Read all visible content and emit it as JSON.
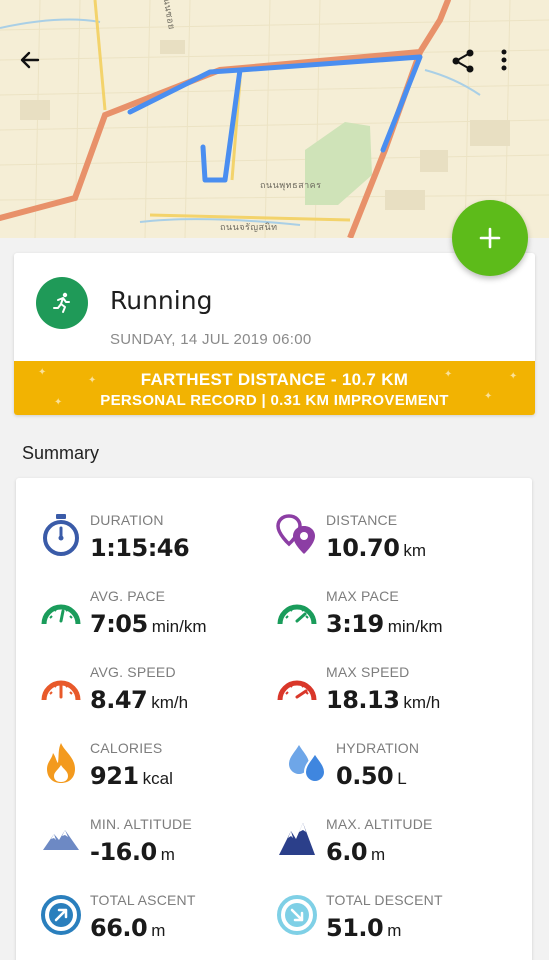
{
  "map": {
    "street_label_1": "ถนนซอย",
    "street_label_2": "ถนนพุทธสาคร",
    "street_label_3": "ถนนจรัญสนิท"
  },
  "toolbar": {
    "back_icon": "arrow-back-icon",
    "share_icon": "share-icon",
    "more_icon": "more-vertical-icon",
    "add_icon": "plus-icon"
  },
  "activity": {
    "title": "Running",
    "date": "SUNDAY, 14 JUL 2019 06:00",
    "icon": "running-person-icon",
    "icon_color": "#1f9a58"
  },
  "record": {
    "line1": "FARTHEST DISTANCE  -  10.7 KM",
    "line2": "PERSONAL RECORD  |  0.31 KM IMPROVEMENT",
    "color": "#f2b302"
  },
  "summary": {
    "title": "Summary",
    "stats": [
      {
        "label": "DURATION",
        "value": "1:15:46",
        "unit": "",
        "icon": "stopwatch-icon"
      },
      {
        "label": "DISTANCE",
        "value": "10.70",
        "unit": "km",
        "icon": "map-pins-icon"
      },
      {
        "label": "AVG. PACE",
        "value": "7:05",
        "unit": "min/km",
        "icon": "gauge-green-icon"
      },
      {
        "label": "MAX PACE",
        "value": "3:19",
        "unit": "min/km",
        "icon": "gauge-green-max-icon"
      },
      {
        "label": "AVG. SPEED",
        "value": "8.47",
        "unit": "km/h",
        "icon": "gauge-orange-icon"
      },
      {
        "label": "MAX SPEED",
        "value": "18.13",
        "unit": "km/h",
        "icon": "gauge-red-icon"
      },
      {
        "label": "CALORIES",
        "value": "921",
        "unit": "kcal",
        "icon": "flame-icon"
      },
      {
        "label": "HYDRATION",
        "value": "0.50",
        "unit": "L",
        "icon": "water-drops-icon"
      },
      {
        "label": "MIN. ALTITUDE",
        "value": "-16.0",
        "unit": "m",
        "icon": "mountain-low-icon"
      },
      {
        "label": "MAX. ALTITUDE",
        "value": "6.0",
        "unit": "m",
        "icon": "mountain-high-icon"
      },
      {
        "label": "TOTAL ASCENT",
        "value": "66.0",
        "unit": "m",
        "icon": "arrow-up-right-circle-icon"
      },
      {
        "label": "TOTAL DESCENT",
        "value": "51.0",
        "unit": "m",
        "icon": "arrow-down-right-circle-icon"
      }
    ]
  }
}
